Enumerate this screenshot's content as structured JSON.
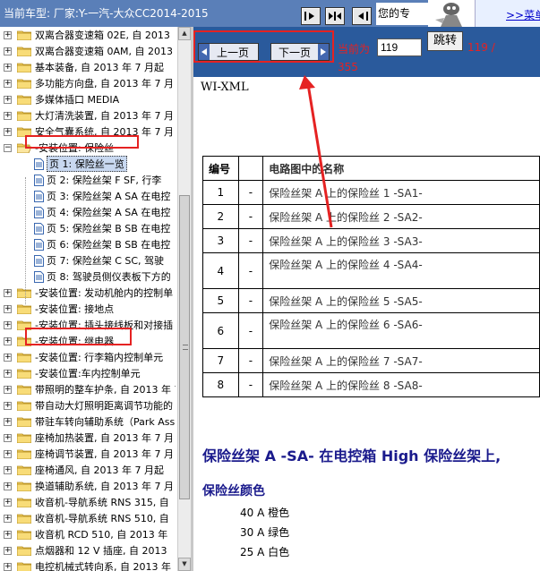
{
  "header": {
    "car_model": "当前车型:   厂家:Y-一汽-大众CC2014-2015",
    "welcome": "您的专",
    "menu_link": ">>菜单"
  },
  "nav": {
    "prev_label": "上一页",
    "next_label": "下一页",
    "current_label": "当前为",
    "current_page": "119",
    "jump_label": "跳转",
    "total_part1": "119 /",
    "total_part2": "355"
  },
  "tree": {
    "items": [
      {
        "label": "双离合器变速箱 02E, 自 2013"
      },
      {
        "label": "双离合器变速箱 0AM, 自 2013"
      },
      {
        "label": "基本装备, 自 2013 年 7 月起"
      },
      {
        "label": "多功能方向盘, 自 2013 年 7 月"
      },
      {
        "label": "多媒体插口 MEDIA"
      },
      {
        "label": "大灯清洗装置, 自 2013 年 7 月"
      },
      {
        "label": "安全气囊系统, 自 2013 年 7 月"
      },
      {
        "label": "-安装位置: 保险丝"
      },
      {
        "label": "-安装位置: 发动机舱内的控制单"
      },
      {
        "label": "-安装位置: 接地点"
      },
      {
        "label": "-安装位置: 插头接线板和对接插"
      },
      {
        "label": "-安装位置: 继电器"
      },
      {
        "label": "-安装位置: 行李箱内控制单元"
      },
      {
        "label": "-安装位置:车内控制单元"
      },
      {
        "label": "带照明的整车护条, 自 2013 年 7"
      },
      {
        "label": "带自动大灯照明距离调节功能的"
      },
      {
        "label": "带驻车转向辅助系统（Park Ass"
      },
      {
        "label": "座椅加热装置, 自 2013 年 7 月"
      },
      {
        "label": "座椅调节装置, 自 2013 年 7 月"
      },
      {
        "label": "座椅通风, 自 2013 年 7 月起"
      },
      {
        "label": "换道辅助系统, 自 2013 年 7 月"
      },
      {
        "label": "收音机-导航系统 RNS 315, 自"
      },
      {
        "label": "收音机-导航系统 RNS 510, 自"
      },
      {
        "label": "收音机 RCD 510, 自 2013 年"
      },
      {
        "label": "点烟器和 12 V 插座, 自 2013"
      },
      {
        "label": "电控机械式转向系, 自 2013 年"
      }
    ],
    "children": [
      {
        "label": "页 1: 保险丝一览"
      },
      {
        "label": "页 2: 保险丝架 F SF, 行李"
      },
      {
        "label": "页 3: 保险丝架 A SA 在电控"
      },
      {
        "label": "页 4: 保险丝架 A SA 在电控"
      },
      {
        "label": "页 5: 保险丝架 B SB 在电控"
      },
      {
        "label": "页 6: 保险丝架 B SB 在电控"
      },
      {
        "label": "页 7: 保险丝架 C SC, 驾驶"
      },
      {
        "label": "页 8: 驾驶员侧仪表板下方的"
      }
    ]
  },
  "content": {
    "doc_type": "WI-XML",
    "table": {
      "headers": [
        "编号",
        "",
        "电路图中的名称"
      ],
      "rows": [
        {
          "num": "1",
          "dash": "-",
          "name": "保险丝架 A 上的保险丝 1 -SA1-"
        },
        {
          "num": "2",
          "dash": "-",
          "name": "保险丝架 A 上的保险丝 2 -SA2-"
        },
        {
          "num": "3",
          "dash": "-",
          "name": "保险丝架 A 上的保险丝 3 -SA3-"
        },
        {
          "num": "4",
          "dash": "-",
          "name": "保险丝架 A 上的保险丝 4 -SA4-"
        },
        {
          "num": "5",
          "dash": "-",
          "name": "保险丝架 A 上的保险丝 5 -SA5-"
        },
        {
          "num": "6",
          "dash": "-",
          "name": "保险丝架 A 上的保险丝 6 -SA6-"
        },
        {
          "num": "7",
          "dash": "-",
          "name": "保险丝架 A 上的保险丝 7 -SA7-"
        },
        {
          "num": "8",
          "dash": "-",
          "name": "保险丝架 A 上的保险丝 8 -SA8-"
        }
      ]
    },
    "big_heading": "保险丝架 A -SA- 在电控箱 High 保险丝架上,",
    "color_heading": "保险丝颜色",
    "colors": [
      {
        "text": "40 A 橙色"
      },
      {
        "text": "30 A 绿色"
      },
      {
        "text": "25 A 白色"
      }
    ]
  },
  "colors": {
    "header_bg": "#5a7fb8",
    "nav_bg": "#2a5a9c",
    "annotation_red": "#e52222",
    "heading_blue": "#1a1a8c"
  }
}
